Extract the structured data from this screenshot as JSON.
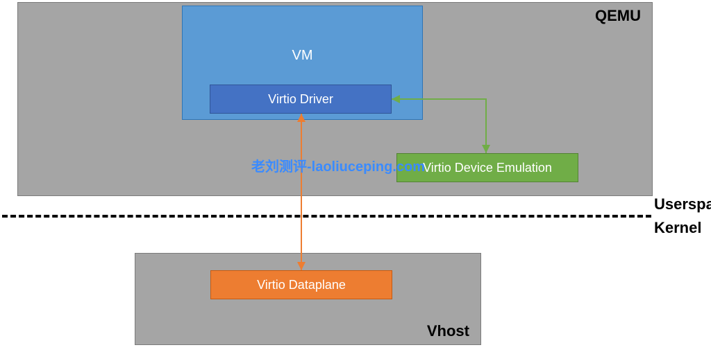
{
  "qemu": {
    "label": "QEMU"
  },
  "vm": {
    "label": "VM"
  },
  "virtio_driver": {
    "label": "Virtio Driver"
  },
  "virtio_emulation": {
    "label": "Virtio Device Emulation"
  },
  "vhost": {
    "label": "Vhost"
  },
  "virtio_dataplane": {
    "label": "Virtio Dataplane"
  },
  "space": {
    "upper": "Userspace",
    "lower": "Kernel"
  },
  "watermark": "老刘测评-laoliuceping.com",
  "connectors": {
    "control": {
      "color": "#70ad47",
      "from": "virtio-driver",
      "to": "virtio-device-emulation"
    },
    "data": {
      "color": "#ed7d31",
      "from": "virtio-driver",
      "to": "virtio-dataplane"
    }
  }
}
